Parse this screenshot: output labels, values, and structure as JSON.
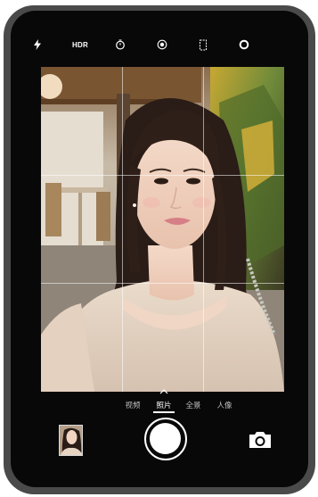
{
  "top_bar": {
    "flash_icon": "flash-icon",
    "hdr_label": "HDR",
    "timer_icon": "timer-icon",
    "live_icon": "live-photo-icon",
    "aspect_icon": "aspect-ratio-icon",
    "filter_icon": "filter-icon"
  },
  "viewfinder": {
    "grid": "3x3"
  },
  "modes": {
    "items": [
      {
        "label": "视频",
        "active": false
      },
      {
        "label": "照片",
        "active": true
      },
      {
        "label": "全景",
        "active": false
      },
      {
        "label": "人像",
        "active": false
      }
    ],
    "caret_icon": "chevron-up-icon"
  },
  "bottom_bar": {
    "thumbnail": "last-photo-thumbnail",
    "shutter": "shutter-button",
    "switch_camera_icon": "camera-switch-icon"
  },
  "colors": {
    "device_frame": "#4a4a4a",
    "screen_bg": "#080808",
    "text_active": "#ffffff",
    "text_inactive": "#bdbdbd"
  }
}
